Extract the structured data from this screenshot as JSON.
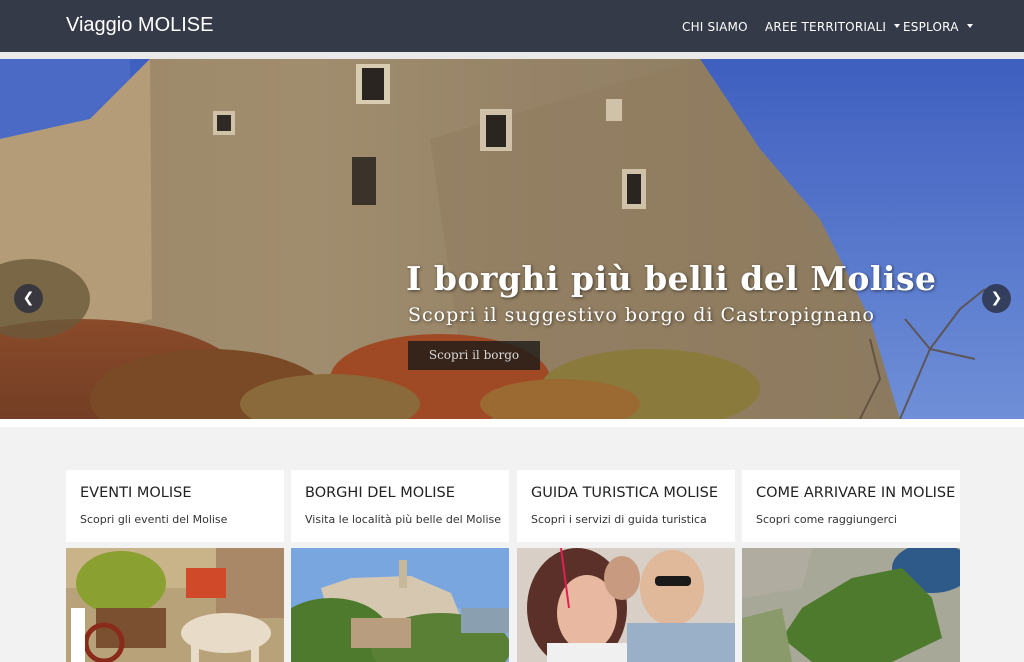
{
  "navbar": {
    "brand": "Viaggio MOLISE",
    "items": [
      {
        "label": "CHI SIAMO",
        "dropdown": false
      },
      {
        "label": "AREE TERRITORIALI",
        "dropdown": true
      },
      {
        "label": "ESPLORA",
        "dropdown": true
      }
    ],
    "background": "#353a48"
  },
  "hero": {
    "title": "I borghi più belli del Molise",
    "subtitle": "Scopri il suggestivo borgo di Castropignano",
    "button_label": "Scopri il borgo",
    "prev_icon": "chevron-left-icon",
    "next_icon": "chevron-right-icon"
  },
  "cards": [
    {
      "title": "EVENTI MOLISE",
      "description": "Scopri gli eventi del Molise"
    },
    {
      "title": "BORGHI DEL MOLISE",
      "description": "Visita le località più belle del Molise"
    },
    {
      "title": "GUIDA TURISTICA MOLISE",
      "description": "Scopri i servizi di guida turistica"
    },
    {
      "title": "COME ARRIVARE IN MOLISE",
      "description": "Scopri come raggiungerci"
    }
  ]
}
